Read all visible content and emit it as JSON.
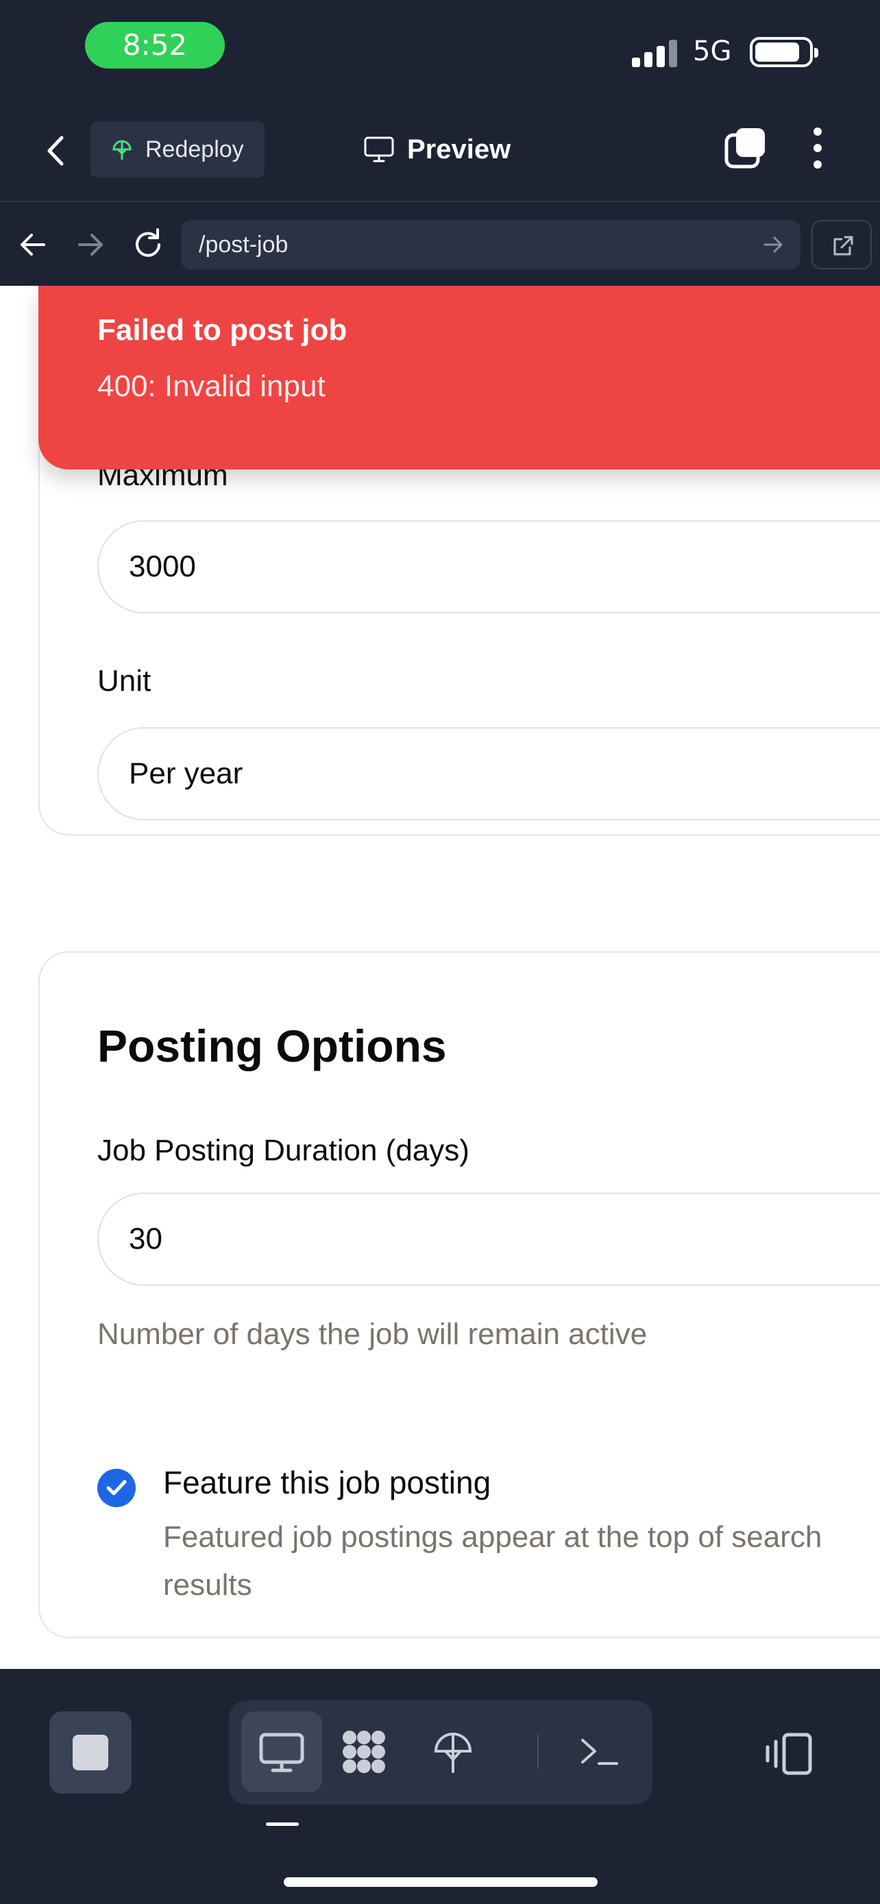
{
  "status_bar": {
    "time": "8:52",
    "network": "5G"
  },
  "top_nav": {
    "redeploy_label": "Redeploy",
    "preview_label": "Preview"
  },
  "url_bar": {
    "url": "/post-job"
  },
  "toast": {
    "title": "Failed to post job",
    "message": "400: Invalid input"
  },
  "salary": {
    "maximum_label": "Maximum",
    "maximum_value": "3000",
    "unit_label": "Unit",
    "unit_value": "Per year"
  },
  "posting_options": {
    "title": "Posting Options",
    "duration_label": "Job Posting Duration (days)",
    "duration_value": "30",
    "duration_help": "Number of days the job will remain active",
    "feature_label": "Feature this job posting",
    "feature_description": "Featured job postings appear at the top of search results",
    "feature_checked": true
  },
  "colors": {
    "toast_bg": "#ef4444",
    "checkbox": "#1f66e5",
    "status_pill": "#30d158",
    "chrome_bg": "#1d2333"
  }
}
